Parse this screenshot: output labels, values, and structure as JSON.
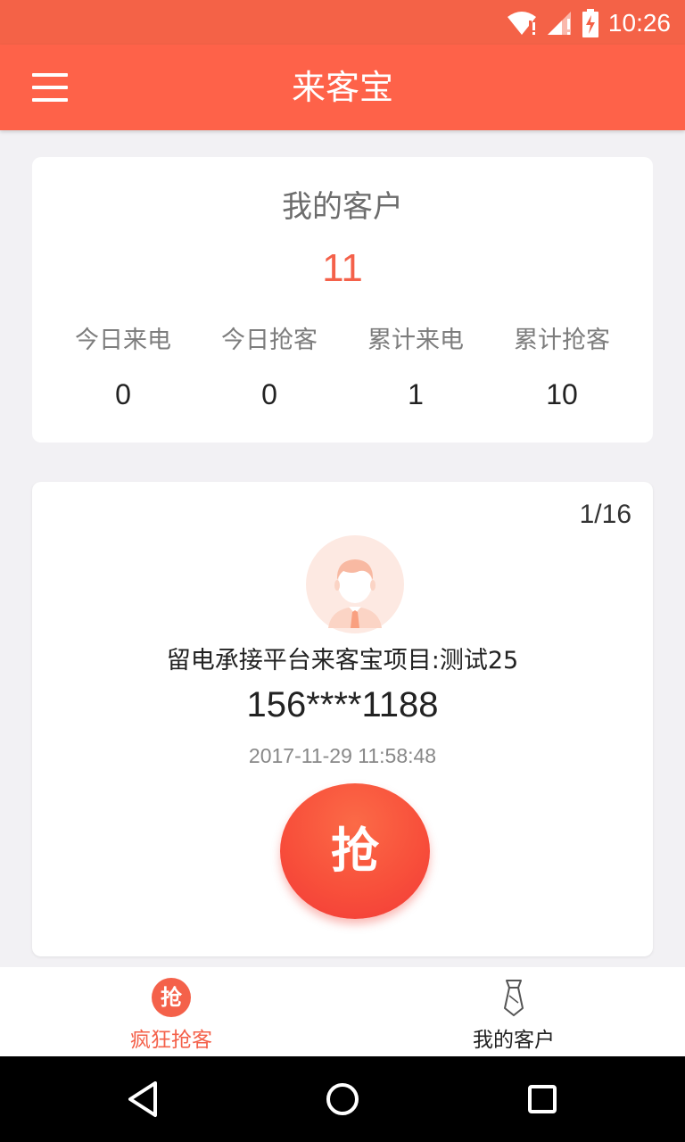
{
  "status_bar": {
    "time": "10:26"
  },
  "app_bar": {
    "title": "来客宝"
  },
  "summary": {
    "title": "我的客户",
    "count": "11",
    "stats": [
      {
        "label": "今日来电",
        "value": "0"
      },
      {
        "label": "今日抢客",
        "value": "0"
      },
      {
        "label": "累计来电",
        "value": "1"
      },
      {
        "label": "累计抢客",
        "value": "10"
      }
    ]
  },
  "lead": {
    "pager": "1/16",
    "project": "留电承接平台来客宝项目:测试25",
    "phone": "156****1188",
    "time": "2017-11-29 11:58:48",
    "grab_label": "抢"
  },
  "tab_bar": {
    "tabs": [
      {
        "label": "疯狂抢客",
        "icon_text": "抢",
        "active": true
      },
      {
        "label": "我的客户",
        "active": false
      }
    ]
  },
  "colors": {
    "accent": "#f4614a",
    "header": "#fe6249",
    "background": "#f2f1f4"
  },
  "icons": {
    "menu": "hamburger-menu-icon",
    "wifi": "wifi-icon",
    "signal": "signal-icon",
    "battery": "battery-charging-icon",
    "avatar": "user-avatar-icon",
    "tie": "tie-icon",
    "back": "back-triangle-icon",
    "home": "home-circle-icon",
    "recents": "recents-square-icon"
  }
}
